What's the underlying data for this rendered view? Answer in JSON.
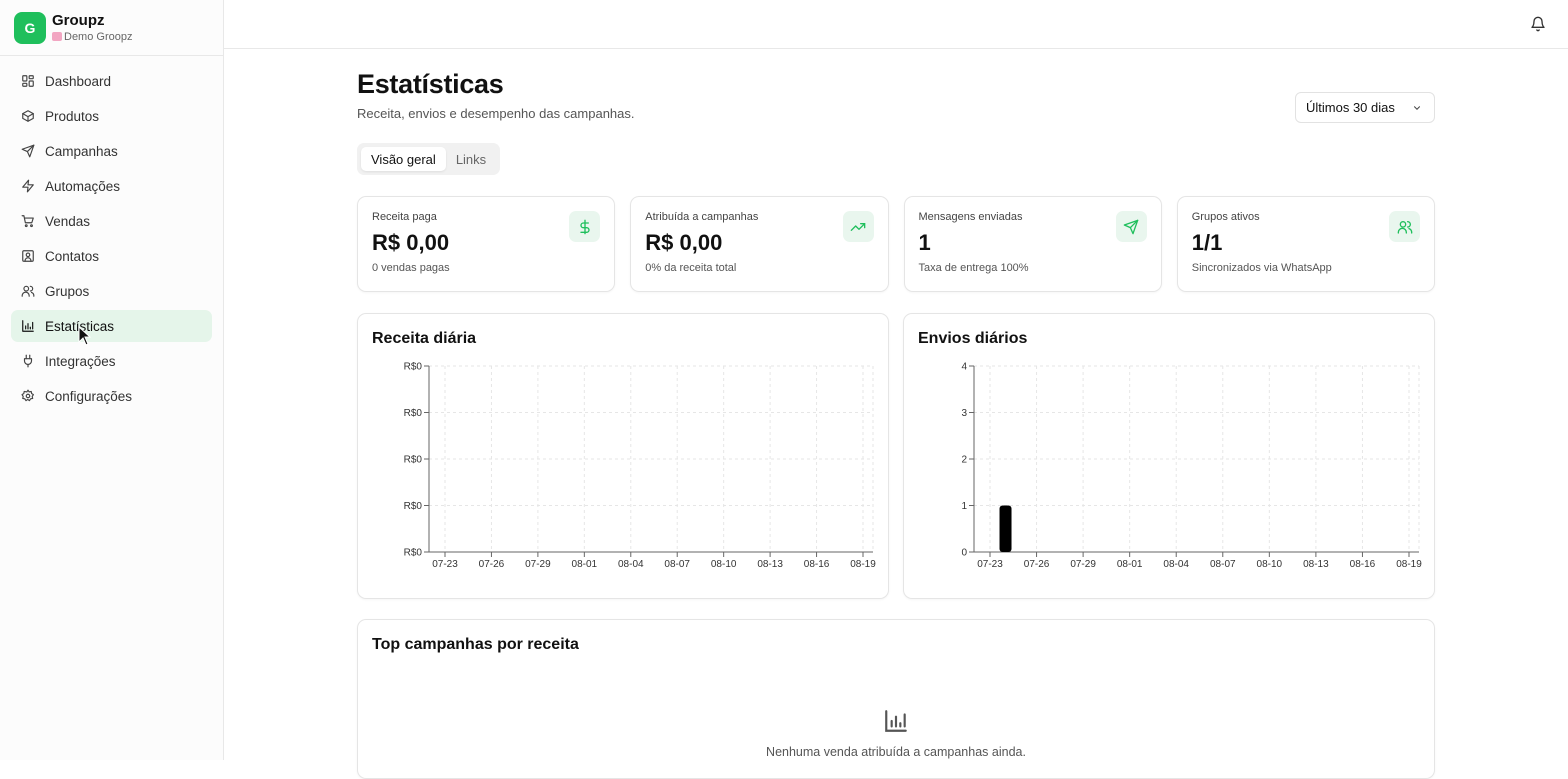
{
  "brand": {
    "initial": "G",
    "name": "Groupz",
    "workspace": "Demo Groopz"
  },
  "sidebar": {
    "items": [
      {
        "label": "Dashboard",
        "icon": "dashboard-icon",
        "active": false
      },
      {
        "label": "Produtos",
        "icon": "package-icon",
        "active": false
      },
      {
        "label": "Campanhas",
        "icon": "send-icon",
        "active": false
      },
      {
        "label": "Automações",
        "icon": "zap-icon",
        "active": false
      },
      {
        "label": "Vendas",
        "icon": "cart-icon",
        "active": false
      },
      {
        "label": "Contatos",
        "icon": "contact-icon",
        "active": false
      },
      {
        "label": "Grupos",
        "icon": "users-icon",
        "active": false
      },
      {
        "label": "Estatísticas",
        "icon": "bar-chart-icon",
        "active": true
      },
      {
        "label": "Integrações",
        "icon": "plug-icon",
        "active": false
      },
      {
        "label": "Configurações",
        "icon": "gear-icon",
        "active": false
      }
    ]
  },
  "header": {
    "title": "Estatísticas",
    "subtitle": "Receita, envios e desempenho das campanhas."
  },
  "range": {
    "selected": "Últimos 30 dias"
  },
  "tabs": [
    {
      "label": "Visão geral",
      "active": true
    },
    {
      "label": "Links",
      "active": false
    }
  ],
  "stats": [
    {
      "label": "Receita paga",
      "value": "R$ 0,00",
      "sub": "0 vendas pagas",
      "icon": "dollar-icon"
    },
    {
      "label": "Atribuída a campanhas",
      "value": "R$ 0,00",
      "sub": "0% da receita total",
      "icon": "trending-up-icon"
    },
    {
      "label": "Mensagens enviadas",
      "value": "1",
      "sub": "Taxa de entrega 100%",
      "icon": "send-icon"
    },
    {
      "label": "Grupos ativos",
      "value": "1/1",
      "sub": "Sincronizados via WhatsApp",
      "icon": "users-icon"
    }
  ],
  "accent_color": "#1fbf5c",
  "chart_data": [
    {
      "type": "bar",
      "title": "Receita diária",
      "categories": [
        "07-23",
        "07-26",
        "07-29",
        "08-01",
        "08-04",
        "08-07",
        "08-10",
        "08-13",
        "08-16",
        "08-19"
      ],
      "values": [
        0,
        0,
        0,
        0,
        0,
        0,
        0,
        0,
        0,
        0
      ],
      "ytick_labels": [
        "R$0",
        "R$0",
        "R$0",
        "R$0",
        "R$0"
      ],
      "grid": true
    },
    {
      "type": "bar",
      "title": "Envios diários",
      "categories": [
        "07-23",
        "07-26",
        "07-29",
        "08-01",
        "08-04",
        "08-07",
        "08-10",
        "08-13",
        "08-16",
        "08-19"
      ],
      "ylim": [
        0,
        4
      ],
      "ytick_labels": [
        "0",
        "1",
        "2",
        "3",
        "4"
      ],
      "bars": [
        {
          "x": "07-24",
          "y": 1
        }
      ],
      "bar_color": "#000000",
      "grid": true
    }
  ],
  "top_campaigns": {
    "title": "Top campanhas por receita",
    "empty_text": "Nenhuma venda atribuída a campanhas ainda.",
    "empty_icon": "bar-chart-icon"
  }
}
